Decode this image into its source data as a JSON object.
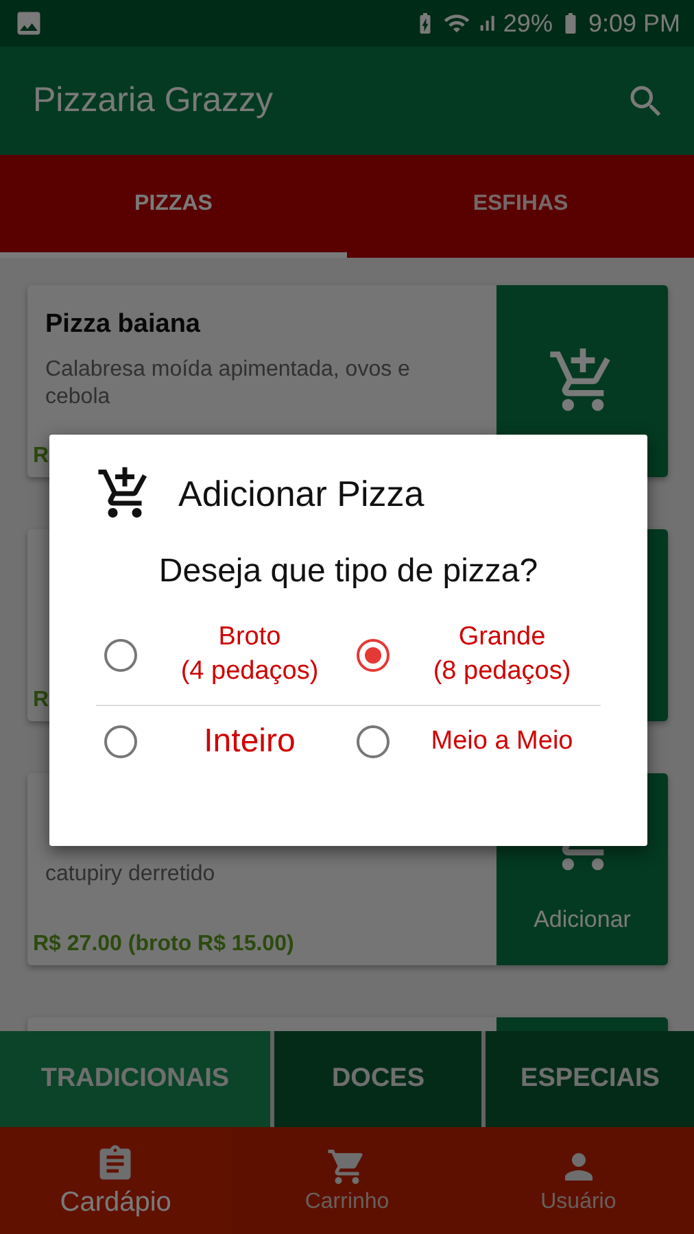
{
  "status_bar": {
    "battery": "29%",
    "time": "9:09 PM"
  },
  "app_bar": {
    "title": "Pizzaria Grazzy"
  },
  "tabs": [
    {
      "label": "PIZZAS",
      "selected": true
    },
    {
      "label": "ESFIHAS",
      "selected": false
    }
  ],
  "cards": [
    {
      "title": "Pizza baiana",
      "description": "Calabresa moída apimentada, ovos e cebola",
      "price": "R"
    },
    {
      "price": "R"
    },
    {
      "description": "catupiry derretido",
      "price": "R$ 27.00 (broto R$ 15.00)",
      "button": "Adicionar"
    }
  ],
  "categories": [
    {
      "label": "TRADICIONAIS",
      "selected": true
    },
    {
      "label": "DOCES",
      "selected": false
    },
    {
      "label": "ESPECIAIS",
      "selected": false
    }
  ],
  "nav": [
    {
      "label": "Cardápio",
      "kind": "menu",
      "selected": true
    },
    {
      "label": "Carrinho",
      "kind": "cart",
      "selected": false
    },
    {
      "label": "Usuário",
      "kind": "user",
      "selected": false
    }
  ],
  "dialog": {
    "title": "Adicionar Pizza",
    "question": "Deseja que tipo de pizza?",
    "options": [
      {
        "label": "Broto\n(4 pedaços)",
        "kind": "normal",
        "selected": false
      },
      {
        "label": "Grande\n(8 pedaços)",
        "kind": "normal",
        "selected": true
      },
      {
        "label": "Inteiro",
        "kind": "big",
        "selected": false
      },
      {
        "label": "Meio a Meio",
        "kind": "normal",
        "selected": false
      }
    ]
  }
}
